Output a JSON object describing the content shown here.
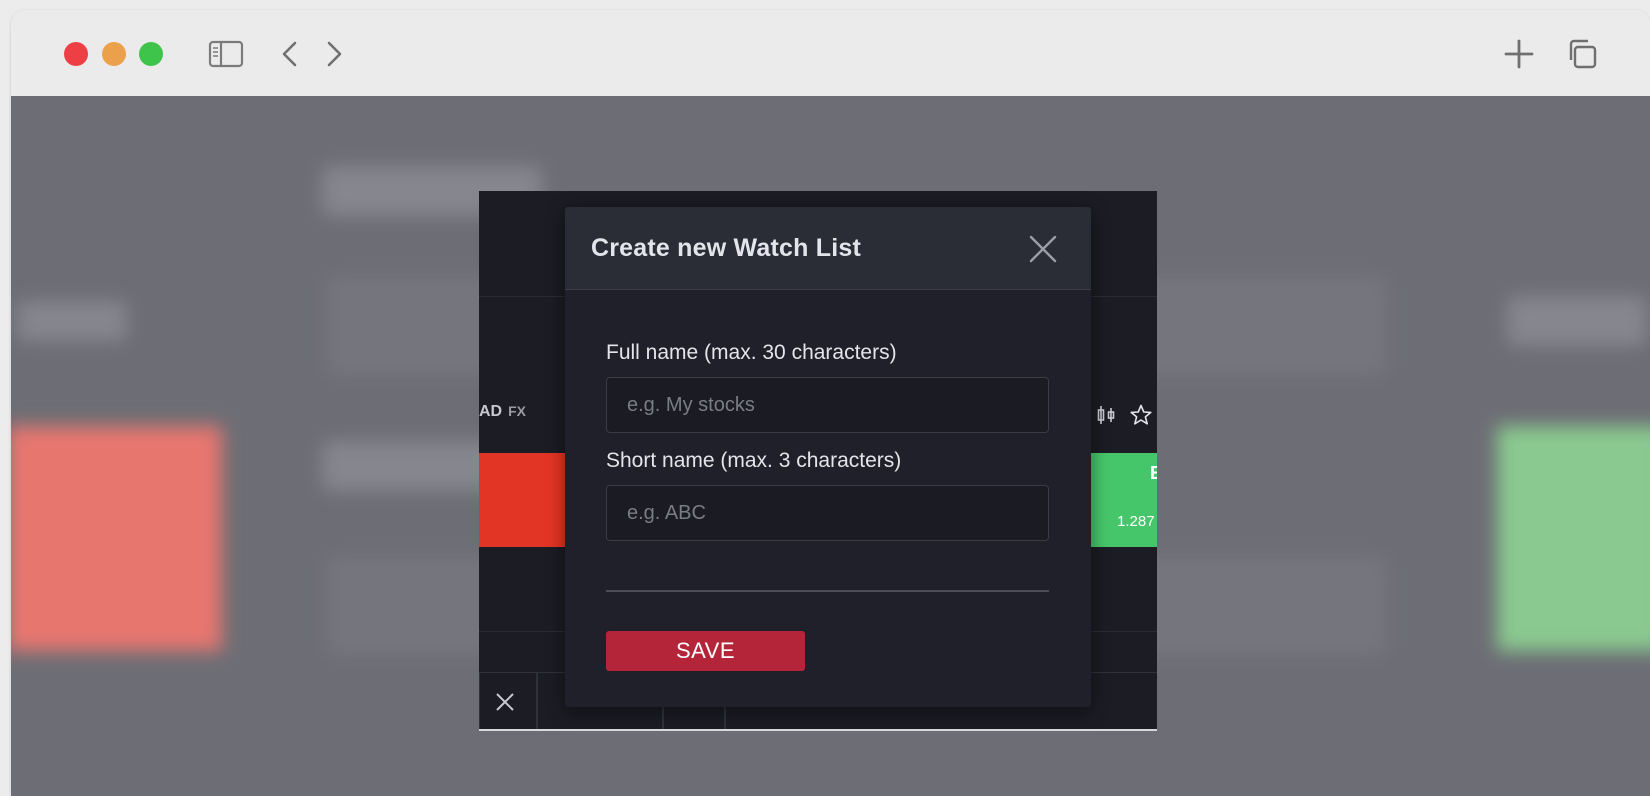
{
  "browser": {
    "traffic_lights": [
      "close",
      "minimize",
      "zoom"
    ],
    "icons": [
      "sidebar-icon",
      "back-icon",
      "forward-icon",
      "new-tab-icon",
      "tabs-overview-icon"
    ]
  },
  "background_app": {
    "symbol_fragment": "AD",
    "market_badge": "FX",
    "green_tile_letter": "E",
    "green_tile_price": "1.287",
    "colors": {
      "sell": "#e33525",
      "buy": "#45c66b"
    }
  },
  "modal": {
    "title": "Create new Watch List",
    "full_name": {
      "label": "Full name (max. 30 characters)",
      "placeholder": "e.g. My stocks",
      "value": ""
    },
    "short_name": {
      "label": "Short name (max. 3 characters)",
      "placeholder": "e.g. ABC",
      "value": ""
    },
    "save_label": "SAVE",
    "colors": {
      "save_button": "#b4253a",
      "background": "#1f2029"
    }
  }
}
